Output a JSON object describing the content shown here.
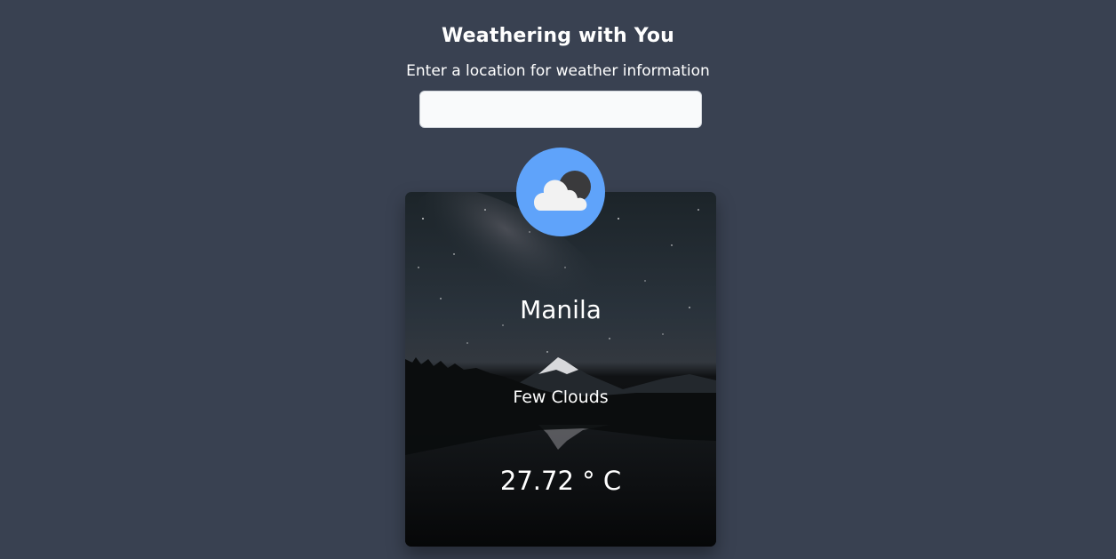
{
  "header": {
    "title": "Weathering with You",
    "subtitle": "Enter a location for weather information"
  },
  "search": {
    "value": "",
    "placeholder": ""
  },
  "weather": {
    "icon": "cloud-moon-icon",
    "city": "Manila",
    "description": "Few Clouds",
    "temperature": "27.72 ° C"
  },
  "colors": {
    "background": "#394151",
    "icon_circle": "#5fa3fa",
    "input_bg": "#f9fafb"
  }
}
